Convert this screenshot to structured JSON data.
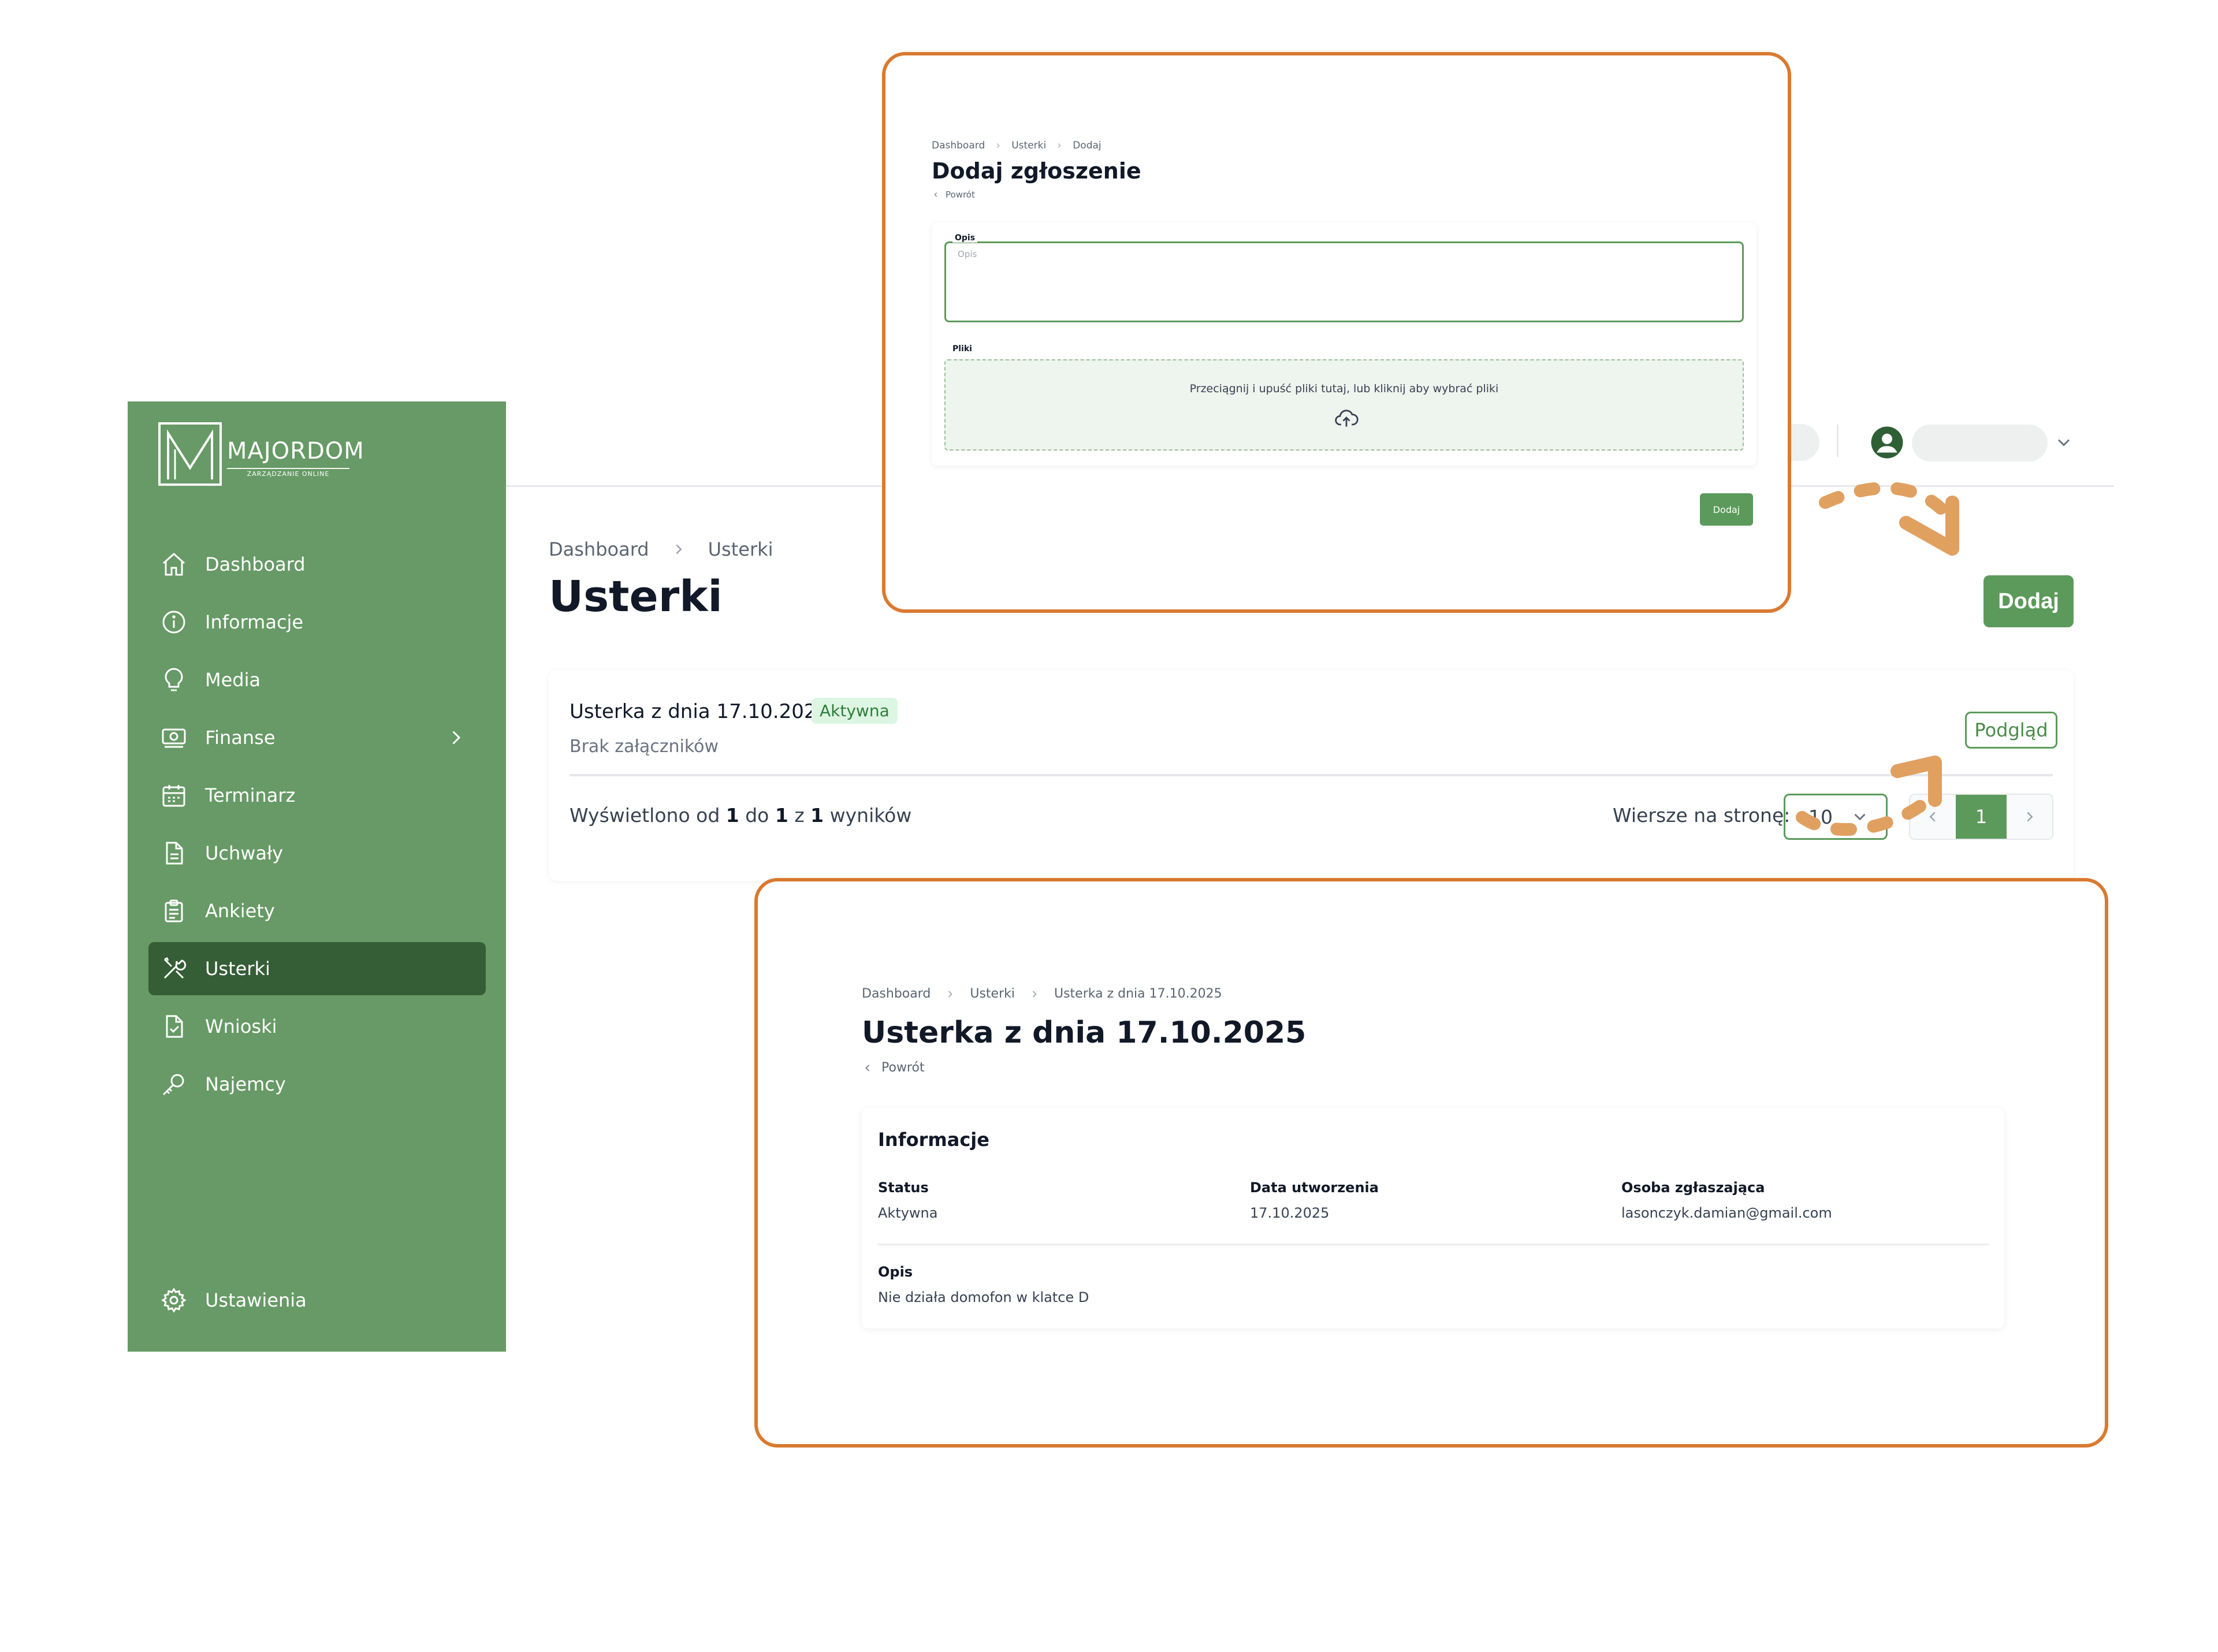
{
  "brand": {
    "name": "MAJORDOM",
    "tagline": "ZARZĄDZANIE ONLINE"
  },
  "sidebar": {
    "items": [
      {
        "label": "Dashboard",
        "icon": "home-icon"
      },
      {
        "label": "Informacje",
        "icon": "info-icon"
      },
      {
        "label": "Media",
        "icon": "lightbulb-icon"
      },
      {
        "label": "Finanse",
        "icon": "money-icon"
      },
      {
        "label": "Terminarz",
        "icon": "calendar-icon"
      },
      {
        "label": "Uchwały",
        "icon": "document-icon"
      },
      {
        "label": "Ankiety",
        "icon": "clipboard-icon"
      },
      {
        "label": "Usterki",
        "icon": "tools-icon"
      },
      {
        "label": "Wnioski",
        "icon": "document-check-icon"
      },
      {
        "label": "Najemcy",
        "icon": "key-icon"
      }
    ],
    "settings": {
      "label": "Ustawienia",
      "icon": "gear-icon"
    },
    "active": "Usterki"
  },
  "main": {
    "breadcrumb": [
      "Dashboard",
      "Usterki"
    ],
    "title": "Usterki",
    "add_button": "Dodaj",
    "item": {
      "title": "Usterka z dnia 17.10.2025",
      "status": "Aktywna",
      "attachments": "Brak załączników",
      "preview_button": "Podgląd"
    },
    "pagination": {
      "results_prefix": "Wyświetlono od",
      "from": "1",
      "to_word": "do",
      "to": "1",
      "of_word": "z",
      "total": "1",
      "results_suffix": "wyników",
      "rows_label": "Wiersze na stronę:",
      "rows_value": "10",
      "current_page": "1"
    }
  },
  "add_form": {
    "breadcrumb": [
      "Dashboard",
      "Usterki",
      "Dodaj"
    ],
    "title": "Dodaj zgłoszenie",
    "back": "Powrót",
    "description_label": "Opis",
    "description_placeholder": "Opis",
    "files_label": "Pliki",
    "dropzone_text": "Przeciągnij i upuść pliki tutaj, lub kliknij aby wybrać pliki",
    "submit": "Dodaj"
  },
  "detail": {
    "breadcrumb": [
      "Dashboard",
      "Usterki",
      "Usterka z dnia 17.10.2025"
    ],
    "title": "Usterka z dnia 17.10.2025",
    "back": "Powrót",
    "section_title": "Informacje",
    "fields": [
      {
        "label": "Status",
        "value": "Aktywna"
      },
      {
        "label": "Data utworzenia",
        "value": "17.10.2025"
      },
      {
        "label": "Osoba zgłaszająca",
        "value": "lasonczyk.damian@gmail.com"
      }
    ],
    "description_label": "Opis",
    "description_value": "Nie działa domofon w klatce D"
  },
  "colors": {
    "sidebar": "#679a66",
    "sidebar_active": "#355e36",
    "accent": "#5b9a5a",
    "highlight_border": "#d97a30",
    "arrow": "#e0a060"
  }
}
